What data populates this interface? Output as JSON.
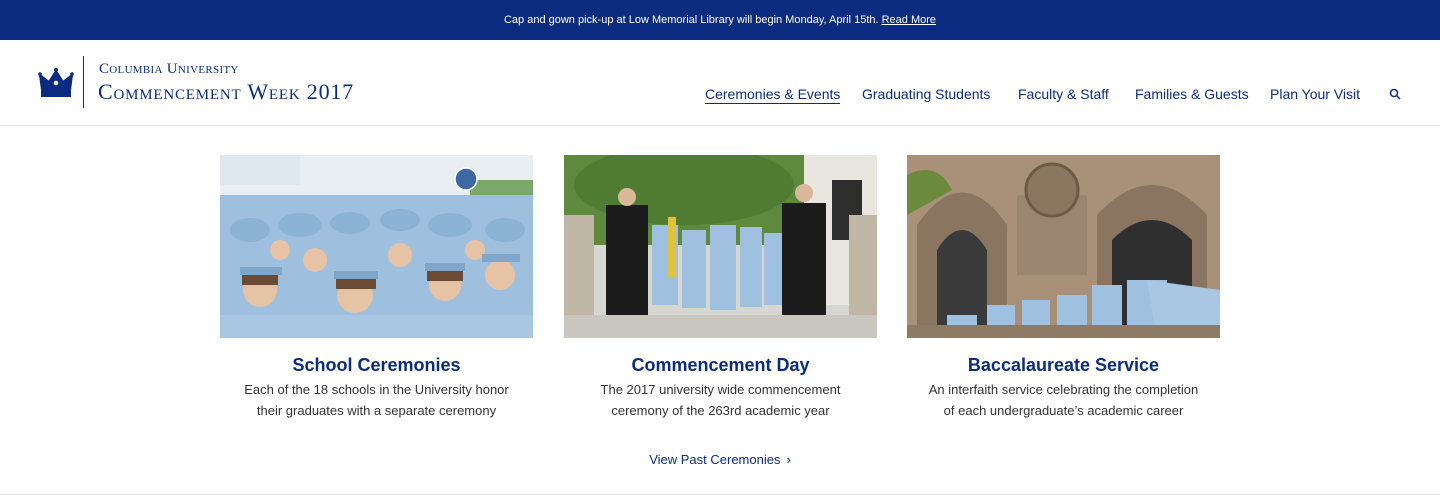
{
  "alert": {
    "message": "Cap and gown pick-up at Low Memorial Library will begin Monday, April 15th.",
    "link_label": "Read More"
  },
  "brand": {
    "university": "Columbia University",
    "event": "Commencement Week 2017",
    "logo_icon": "crown-icon"
  },
  "nav": {
    "items": [
      {
        "label": "Ceremonies & Events",
        "active": true
      },
      {
        "label": "Graduating Students",
        "active": false
      },
      {
        "label": "Faculty & Staff",
        "active": false
      },
      {
        "label": "Families & Guests",
        "active": false
      },
      {
        "label": "Plan Your Visit",
        "active": false
      }
    ],
    "search_icon": "search-icon"
  },
  "cards": [
    {
      "title": "School Ceremonies",
      "desc_line1": "Each of the 18 schools in the University honor",
      "desc_line2": "their graduates with a separate ceremony"
    },
    {
      "title": "Commencement Day",
      "desc_line1": "The 2017 university wide commencement",
      "desc_line2": "ceremony of the 263rd academic year"
    },
    {
      "title": "Baccalaureate Service",
      "desc_line1": "An interfaith service celebrating the completion",
      "desc_line2": "of each undergraduate’s academic career"
    }
  ],
  "view_past": {
    "label": "View Past Ceremonies",
    "chevron": "›"
  },
  "colors": {
    "brand_navy": "#0b2b80",
    "gown_blue": "#8fb3d6",
    "text": "#333333"
  }
}
